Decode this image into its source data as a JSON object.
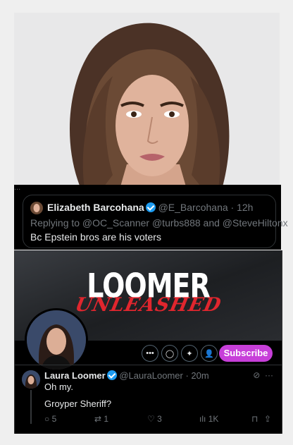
{
  "tweet1": {
    "cut_text": "...",
    "quote_name": "Elizabeth Barcohana",
    "quote_handle": "@E_Barcohana",
    "quote_time": "12h",
    "reply_line": "Replying to @OC_Scanner @turbs888 and @SteveHiltonx",
    "text": "Bc Epstein bros are his voters"
  },
  "profile": {
    "banner_title": "LOOMER",
    "banner_subtitle": "UNLEASHED",
    "subscribe_label": "Subscribe"
  },
  "tweet2": {
    "name": "Laura Loomer",
    "handle": "@LauraLoomer",
    "time": "20m",
    "line1": "Oh my.",
    "line2": "Groyper Sheriff?",
    "replies": "5",
    "reposts": "1",
    "likes": "3",
    "views": "1K"
  },
  "colors": {
    "verified": "#1d9bf0",
    "subscribe": "#c73fd9",
    "banner_sub": "#e0262e"
  }
}
